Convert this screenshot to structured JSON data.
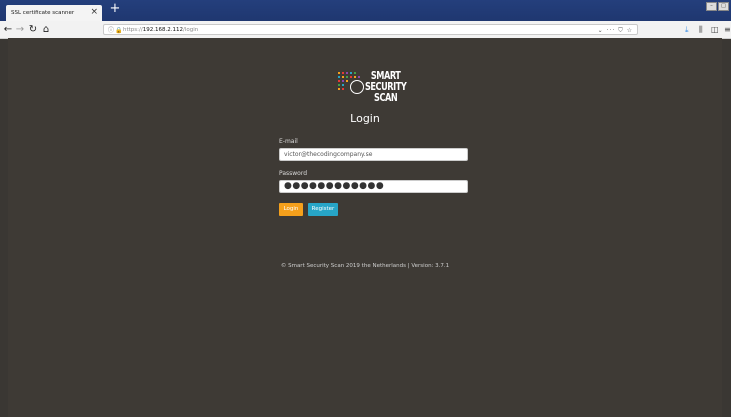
{
  "browser": {
    "tab_title": "SSL certificate scanner",
    "tab_close": "×",
    "new_tab": "+",
    "url_prefix": "https://",
    "url_host": "192.168.2.112",
    "url_path": "/login",
    "url_actions": "⌄ ··· ⛉ ☆"
  },
  "page": {
    "logo": {
      "line1": "SMART",
      "line2": "SECURITY",
      "line3": "SCAN"
    },
    "title": "Login",
    "email_label": "E-mail",
    "email_value": "victor@thecodingcompany.se",
    "password_label": "Password",
    "password_value": "●●●●●●●●●●●●",
    "login_button": "Login",
    "register_button": "Register",
    "footer": "© Smart Security Scan 2019 the Netherlands | Version: 3.7.1"
  },
  "colors": {
    "accent_login": "#f5a01c",
    "accent_register": "#27a5c7",
    "background": "#3e3a35"
  }
}
